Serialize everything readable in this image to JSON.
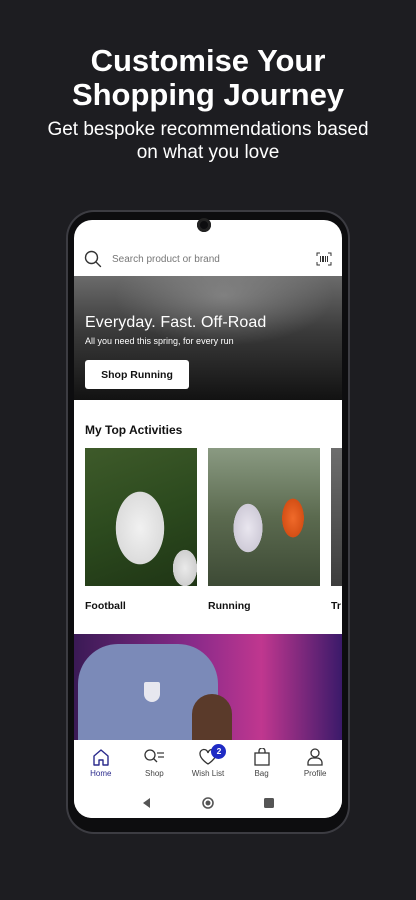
{
  "promo": {
    "title_line1": "Customise Your",
    "title_line2": "Shopping Journey",
    "subtitle_line1": "Get bespoke recommendations based",
    "subtitle_line2": "on what you love"
  },
  "search": {
    "placeholder": "Search product or brand"
  },
  "hero": {
    "title": "Everyday. Fast. Off-Road",
    "subtitle": "All you need this spring, for every run",
    "button_label": "Shop Running"
  },
  "activities": {
    "title": "My Top Activities",
    "items": [
      {
        "label": "Football"
      },
      {
        "label": "Running"
      },
      {
        "label": "Tr"
      }
    ]
  },
  "tabbar": {
    "items": [
      {
        "label": "Home",
        "icon": "home-icon",
        "active": true
      },
      {
        "label": "Shop",
        "icon": "shop-icon"
      },
      {
        "label": "Wish List",
        "icon": "heart-icon",
        "badge": "2"
      },
      {
        "label": "Bag",
        "icon": "bag-icon"
      },
      {
        "label": "Profile",
        "icon": "profile-icon"
      }
    ]
  },
  "colors": {
    "accent": "#1f2bc4",
    "active_tab": "#2a2a8c",
    "background": "#1d1d21"
  }
}
